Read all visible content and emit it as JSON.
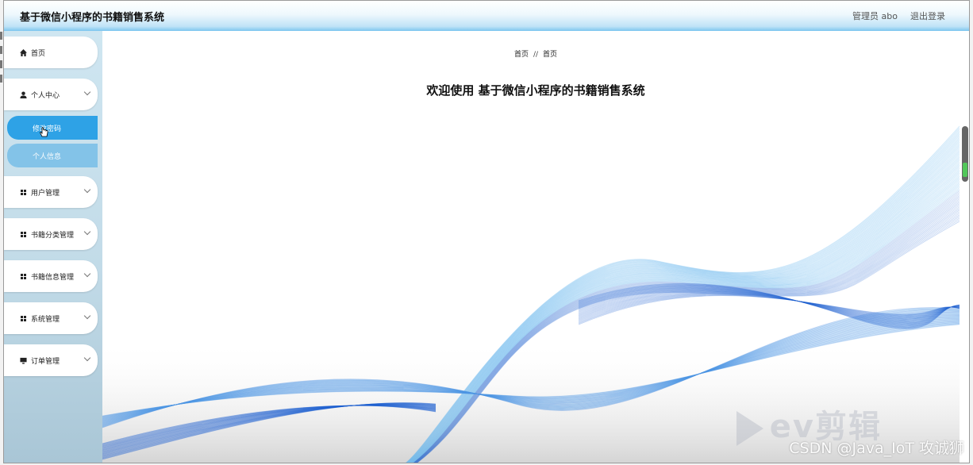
{
  "header": {
    "title": "基于微信小程序的书籍销售系统",
    "user_label": "管理员 abo",
    "logout_label": "退出登录"
  },
  "sidebar": {
    "items": [
      {
        "label": "首页",
        "icon": "home-icon"
      },
      {
        "label": "个人中心",
        "icon": "user-icon"
      },
      {
        "label": "用户管理",
        "icon": "grid-icon"
      },
      {
        "label": "书籍分类管理",
        "icon": "grid-icon"
      },
      {
        "label": "书籍信息管理",
        "icon": "grid-icon"
      },
      {
        "label": "系统管理",
        "icon": "grid-icon"
      },
      {
        "label": "订单管理",
        "icon": "monitor-icon"
      }
    ],
    "sub_items": [
      {
        "label": "修改密码",
        "active": true
      },
      {
        "label": "个人信息",
        "active": false
      }
    ]
  },
  "main": {
    "breadcrumb": [
      "首页",
      "首页"
    ],
    "breadcrumb_sep": "//",
    "welcome": "欢迎使用 基于微信小程序的书籍销售系统"
  },
  "overlay": {
    "watermark": "CSDN @Java_IoT 攻诚狮",
    "ev_logo": "ev剪辑"
  },
  "colors": {
    "accent": "#2ea2e6",
    "header_gradient_end": "#7cc6ef",
    "wave_light": "#6ab8ef",
    "wave_dark": "#1d5fd1"
  }
}
